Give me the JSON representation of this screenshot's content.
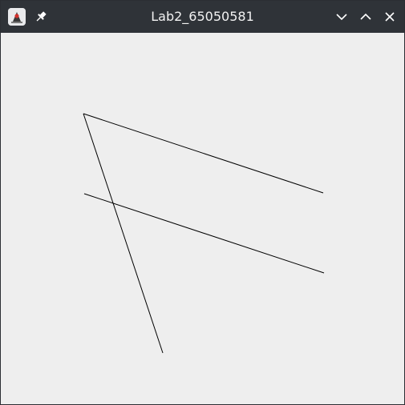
{
  "window": {
    "title": "Lab2_65050581",
    "background_color": "#eeeeee",
    "titlebar_color": "#2f3338"
  },
  "titlebar": {
    "app_icon": "java-duke-icon",
    "pin_icon": "pin-icon",
    "controls": {
      "minimize_icon": "chevron-down-icon",
      "maximize_icon": "chevron-up-icon",
      "close_icon": "close-icon"
    }
  },
  "drawing": {
    "line_color": "#000000"
  }
}
